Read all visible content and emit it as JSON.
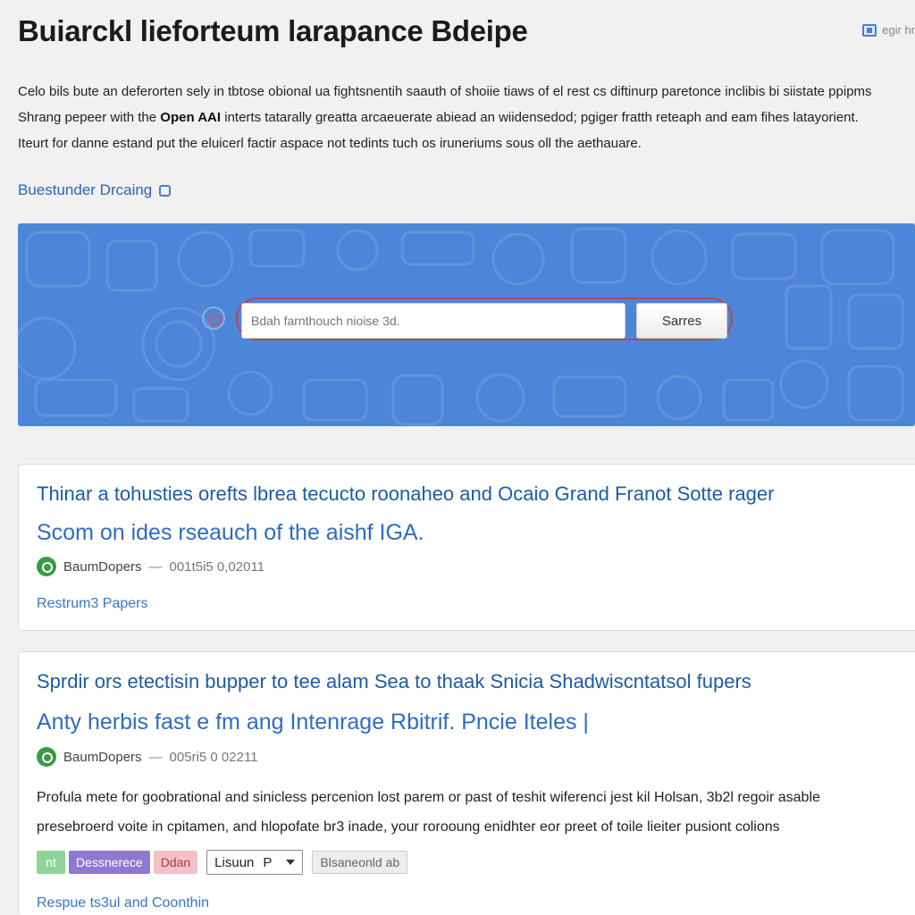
{
  "header": {
    "title": "Buiarckl lieforteum larapance Bdeipe",
    "tool_link": "egir hr"
  },
  "intro": {
    "line1": "Celo bils bute an deferorten sely in tbtose obional ua fightsnentih saauth of shoiie tiaws of el rest cs diftinurp paretonce inclibis bi siistate ppipms",
    "line2_pre": "Shrang pepeer with the",
    "brand": "Open AAI",
    "line2_post": "interts tatarally greatta arcaeuerate abiead an wiidensedod; pgiger fratth reteaph and eam fihes latayorient.",
    "line3": "Iteurt for danne estand put the eluicerl factir aspace not tedints tuch os iruneriums sous oll the aethauare."
  },
  "section_link": {
    "label": "Buestunder Drcaing"
  },
  "search": {
    "placeholder": "Bdah farnthouch nioise 3d.",
    "button_label": "Sarres"
  },
  "results": [
    {
      "title": "Thinar a tohusties orefts lbrea tecucto roonaheo and Ocaio Grand Franot Sotte rager",
      "subtitle": "Scom on ides rseauch of the aishf IGA.",
      "author": "BaumDopers",
      "sep": "—",
      "date": "001t5i5 0,02011",
      "link": "Restrum3 Papers"
    },
    {
      "title": "Sprdir ors etectisin bupper to tee alam Sea to thaak Snicia Shadwiscntatsol fupers",
      "subtitle": "Anty herbis fast e fm ang Intenrage Rbitrif. Pncie Iteles |",
      "author": "BaumDopers",
      "sep": "—",
      "date": "005ri5 0 02211",
      "desc1": "Profula mete for goobrational and sinicless percenion lost parem or past of teshit wiferenci jest kil Holsan, 3b2l regoir asable",
      "desc2": "presebroerd voite in cpitamen, and hlopofate br3 inade, your rorooung enidhter eor preet of toile lieiter pusiont colions",
      "tags": {
        "green": "nt",
        "purple": "Dessnerece",
        "pink": "Ddan",
        "select": "Lisuun",
        "select_badge": "P",
        "plain": "Blsaneonld ab"
      },
      "link": "Respue ts3ul and Coonthin"
    }
  ],
  "colors": {
    "hero": "#4d86d8",
    "link": "#2f64b4",
    "title": "#1d5ba8",
    "search_ring": "#b7455a"
  }
}
